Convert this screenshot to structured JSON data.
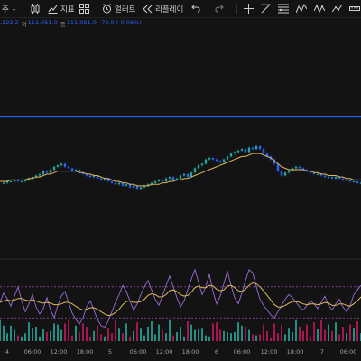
{
  "toolbar": {
    "left_char": "주",
    "chevron": "⌄",
    "indicator_label": "지표",
    "alert_label": "얼러트",
    "replay_label": "리플레이"
  },
  "legend": {
    "high_value": ",123.2",
    "low_label": "저",
    "low_value": "111,051.0",
    "close_label": "종",
    "close_value": "111,051.0",
    "change": "-72.0 (-0.06%)"
  },
  "colors": {
    "up": "#26a69a",
    "down": "#2962ff",
    "ma": "#e0b85a",
    "hline": "#2962ff",
    "osc1": "#9c6bd8",
    "osc2": "#e0b85a",
    "band": "#b05bd6"
  },
  "x_axis": {
    "ticks": [
      "4",
      "06:00",
      "12:00",
      "18:00",
      "5",
      "06:00",
      "12:00",
      "18:00",
      "6",
      "06:00",
      "12:00",
      "18:00",
      "7",
      "06:00"
    ]
  },
  "chart_data": {
    "type": "candlestick",
    "price_series": [
      123,
      123,
      124,
      124,
      125,
      124,
      124,
      125,
      126,
      127,
      128,
      129,
      131,
      130,
      132,
      134,
      135,
      136,
      134,
      133,
      131,
      132,
      130,
      129,
      128,
      127,
      128,
      126,
      125,
      126,
      124,
      123,
      122,
      123,
      121,
      122,
      120,
      121,
      119,
      120,
      121,
      122,
      123,
      124,
      125,
      124,
      126,
      127,
      125,
      126,
      128,
      129,
      127,
      130,
      133,
      135,
      136,
      139,
      140,
      139,
      138,
      137,
      139,
      141,
      143,
      144,
      145,
      146,
      144,
      147,
      146,
      148,
      146,
      143,
      141,
      139,
      136,
      131,
      128,
      130,
      131,
      133,
      134,
      133,
      132,
      131,
      130,
      129,
      129,
      128,
      127,
      127,
      126,
      127,
      126,
      125,
      125,
      124,
      124,
      123,
      123
    ],
    "ma_series": [
      124,
      124,
      124,
      125,
      125,
      125,
      125,
      125,
      126,
      126,
      127,
      127,
      128,
      129,
      129,
      130,
      131,
      131,
      131,
      131,
      131,
      131,
      130,
      130,
      129,
      129,
      128,
      128,
      127,
      126,
      126,
      125,
      124,
      124,
      123,
      123,
      122,
      122,
      121,
      121,
      121,
      121,
      122,
      122,
      122,
      123,
      123,
      124,
      124,
      125,
      125,
      126,
      126,
      127,
      128,
      129,
      130,
      131,
      132,
      133,
      134,
      135,
      136,
      137,
      138,
      139,
      140,
      141,
      141,
      142,
      143,
      143,
      143,
      142,
      141,
      140,
      138,
      136,
      134,
      133,
      132,
      132,
      132,
      132,
      132,
      131,
      131,
      130,
      130,
      129,
      129,
      128,
      128,
      128,
      127,
      127,
      126,
      126,
      125,
      125,
      125
    ],
    "hline_value": 168,
    "oscillator1": [
      50,
      62,
      55,
      45,
      58,
      70,
      52,
      38,
      48,
      60,
      44,
      35,
      42,
      56,
      40,
      30,
      46,
      58,
      64,
      50,
      36,
      28,
      22,
      30,
      44,
      52,
      40,
      28,
      20,
      18,
      26,
      38,
      50,
      60,
      72,
      64,
      52,
      40,
      48,
      60,
      70,
      78,
      66,
      54,
      46,
      58,
      72,
      84,
      70,
      56,
      44,
      52,
      66,
      80,
      92,
      76,
      60,
      70,
      86,
      64,
      48,
      58,
      74,
      90,
      72,
      56,
      48,
      62,
      78,
      92,
      88,
      70,
      54,
      46,
      40,
      34,
      30,
      38,
      46,
      54,
      60,
      56,
      50,
      44,
      40,
      46,
      52,
      48,
      42,
      50,
      58,
      46,
      40,
      48,
      54,
      44,
      38,
      46,
      60,
      66,
      72
    ],
    "oscillator2": [
      50,
      52,
      53,
      52,
      53,
      55,
      55,
      53,
      52,
      53,
      52,
      50,
      49,
      50,
      49,
      47,
      47,
      48,
      50,
      50,
      48,
      45,
      42,
      40,
      41,
      43,
      43,
      41,
      38,
      35,
      33,
      34,
      37,
      41,
      47,
      51,
      52,
      50,
      50,
      51,
      54,
      59,
      61,
      60,
      57,
      57,
      60,
      65,
      66,
      64,
      60,
      58,
      59,
      63,
      69,
      71,
      69,
      69,
      72,
      71,
      67,
      65,
      66,
      71,
      72,
      69,
      65,
      64,
      67,
      72,
      75,
      74,
      70,
      65,
      59,
      53,
      47,
      44,
      44,
      46,
      49,
      51,
      51,
      50,
      48,
      47,
      48,
      48,
      47,
      48,
      50,
      49,
      46,
      46,
      48,
      48,
      46,
      45,
      48,
      52,
      57
    ]
  }
}
